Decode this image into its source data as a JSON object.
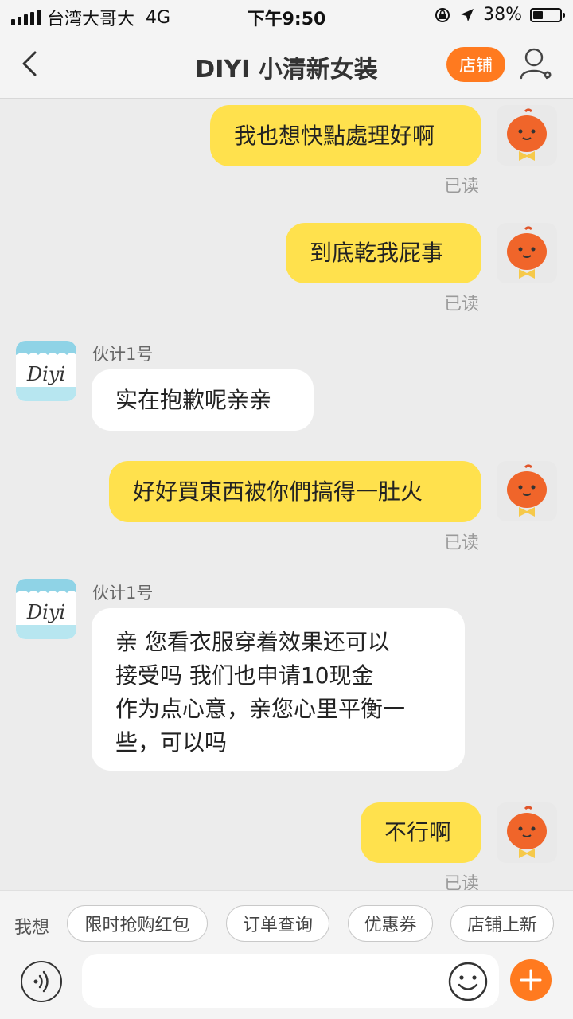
{
  "status_bar": {
    "carrier": "台湾大哥大",
    "network": "4G",
    "time": "下午9:50",
    "battery": "38%",
    "battery_level": 0.38
  },
  "nav": {
    "title": "DIYI 小清新女装",
    "store_button": "店铺"
  },
  "shop_avatar_text": "Diyi",
  "messages": [
    {
      "from": "me",
      "text": "我也想快點處理好啊",
      "status": "已读"
    },
    {
      "from": "me",
      "text": "到底乾我屁事",
      "status": "已读"
    },
    {
      "from": "shop",
      "sender": "伙计1号",
      "text": "实在抱歉呢亲亲"
    },
    {
      "from": "me",
      "text": "好好買東西被你們搞得一肚火",
      "status": "已读"
    },
    {
      "from": "shop",
      "sender": "伙计1号",
      "lines": [
        "亲 您看衣服穿着效果还可以",
        "接受吗  我们也申请10现金",
        "作为点心意，亲您心里平衡一",
        "些，可以吗"
      ]
    },
    {
      "from": "me",
      "text": "不行啊",
      "status": "已读"
    }
  ],
  "quick_replies": {
    "lead": "我想",
    "chips": [
      "限时抢购红包",
      "订单查询",
      "优惠券",
      "店铺上新"
    ]
  },
  "input": {
    "placeholder": "",
    "value": ""
  },
  "icons": {
    "back": "back-arrow-icon",
    "profile": "user-settings-icon",
    "voice": "voice-icon",
    "emoji": "emoji-icon",
    "plus": "plus-icon"
  },
  "colors": {
    "accent": "#ff7a1f",
    "my_bubble": "#ffe14d",
    "background": "#ececec"
  }
}
